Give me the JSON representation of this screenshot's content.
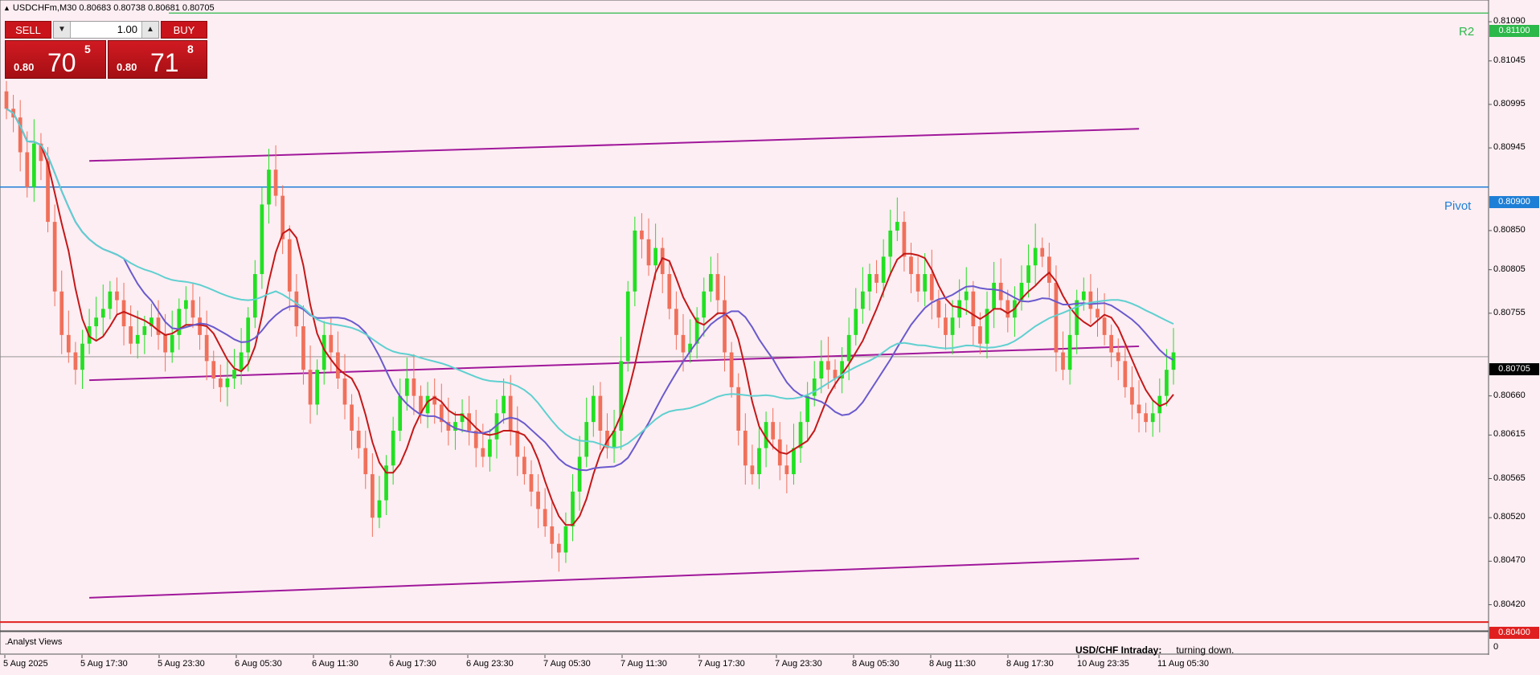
{
  "header": {
    "symbol_line": "USDCHFm,M30  0.80683 0.80738 0.80681 0.80705"
  },
  "trade_panel": {
    "sell_label": "SELL",
    "buy_label": "BUY",
    "lot_value": "1.00",
    "sell_price": {
      "big": "0.80",
      "mid": "70",
      "sup": "5"
    },
    "buy_price": {
      "big": "0.80",
      "mid": "71",
      "sup": "8"
    }
  },
  "levels": {
    "r2": {
      "label": "R2",
      "value": "0.81100",
      "color": "#2db84a"
    },
    "pivot": {
      "label": "Pivot",
      "value": "0.80900",
      "color": "#1e7fd6"
    },
    "current": {
      "value": "0.80705"
    },
    "s_line": {
      "value": "0.80400",
      "color": "#e02020"
    }
  },
  "y_ticks": [
    "0.81090",
    "0.81045",
    "0.80995",
    "0.80945",
    "0.80850",
    "0.80805",
    "0.80755",
    "0.80660",
    "0.80615",
    "0.80565",
    "0.80520",
    "0.80470",
    "0.80420"
  ],
  "x_ticks": [
    "5 Aug 2025",
    "5 Aug 17:30",
    "5 Aug 23:30",
    "6 Aug 05:30",
    "6 Aug 11:30",
    "6 Aug 17:30",
    "6 Aug 23:30",
    "7 Aug 05:30",
    "7 Aug 11:30",
    "7 Aug 17:30",
    "7 Aug 23:30",
    "8 Aug 05:30",
    "8 Aug 11:30",
    "8 Aug 17:30",
    "10 Aug 23:35",
    "11 Aug 05:30"
  ],
  "subwindow": {
    "label": ".Analyst Views",
    "zero_tick": "0",
    "status_title": "USD/CHF Intraday:",
    "status_text": "turning down."
  },
  "colors": {
    "background": "#fdeef3",
    "bull": "#22e022",
    "bear": "#f0705a",
    "ma_fast": "#c41818",
    "ma_mid": "#6a5acd",
    "ma_slow": "#5fd0d0",
    "channel": "#a0189a"
  },
  "chart_data": {
    "type": "candlestick",
    "timeframe": "M30",
    "ylim": [
      0.8039,
      0.81115
    ],
    "closes": [
      0.8099,
      0.8098,
      0.8094,
      0.809,
      0.8095,
      0.8093,
      0.8086,
      0.8078,
      0.8073,
      0.8071,
      0.8069,
      0.8072,
      0.8074,
      0.8075,
      0.8076,
      0.8078,
      0.8077,
      0.8074,
      0.8072,
      0.8073,
      0.8074,
      0.8075,
      0.8073,
      0.8071,
      0.8073,
      0.8076,
      0.8077,
      0.8075,
      0.8073,
      0.807,
      0.8068,
      0.8067,
      0.8068,
      0.8069,
      0.8071,
      0.8075,
      0.808,
      0.8088,
      0.8092,
      0.8089,
      0.8084,
      0.8078,
      0.8074,
      0.8069,
      0.8065,
      0.8069,
      0.8073,
      0.8071,
      0.8068,
      0.8065,
      0.8062,
      0.806,
      0.8057,
      0.8052,
      0.8054,
      0.8058,
      0.8062,
      0.8066,
      0.8068,
      0.8066,
      0.8064,
      0.8066,
      0.8065,
      0.8063,
      0.8062,
      0.8063,
      0.8064,
      0.8062,
      0.806,
      0.8059,
      0.8061,
      0.8064,
      0.8066,
      0.8062,
      0.8059,
      0.8057,
      0.8055,
      0.8053,
      0.8051,
      0.8049,
      0.8048,
      0.8051,
      0.8055,
      0.8059,
      0.8063,
      0.8066,
      0.8062,
      0.806,
      0.8062,
      0.807,
      0.8078,
      0.8085,
      0.8084,
      0.8081,
      0.8083,
      0.808,
      0.8076,
      0.8073,
      0.8071,
      0.8072,
      0.8075,
      0.8078,
      0.808,
      0.8077,
      0.8071,
      0.8067,
      0.8062,
      0.8058,
      0.8057,
      0.806,
      0.8063,
      0.8061,
      0.8058,
      0.8057,
      0.806,
      0.8063,
      0.8066,
      0.8068,
      0.807,
      0.8069,
      0.8068,
      0.807,
      0.8073,
      0.8076,
      0.8078,
      0.808,
      0.8079,
      0.8082,
      0.8085,
      0.8086,
      0.8082,
      0.808,
      0.8078,
      0.808,
      0.8077,
      0.8075,
      0.8073,
      0.8075,
      0.8077,
      0.8078,
      0.8074,
      0.8072,
      0.8076,
      0.8079,
      0.8077,
      0.8075,
      0.8077,
      0.8079,
      0.8081,
      0.8083,
      0.8082,
      0.8079,
      0.8071,
      0.8069,
      0.8073,
      0.8077,
      0.8078,
      0.8076,
      0.8075,
      0.8073,
      0.8071,
      0.807,
      0.8067,
      0.8065,
      0.8064,
      0.8063,
      0.8064,
      0.8066,
      0.8069,
      0.8071
    ]
  }
}
